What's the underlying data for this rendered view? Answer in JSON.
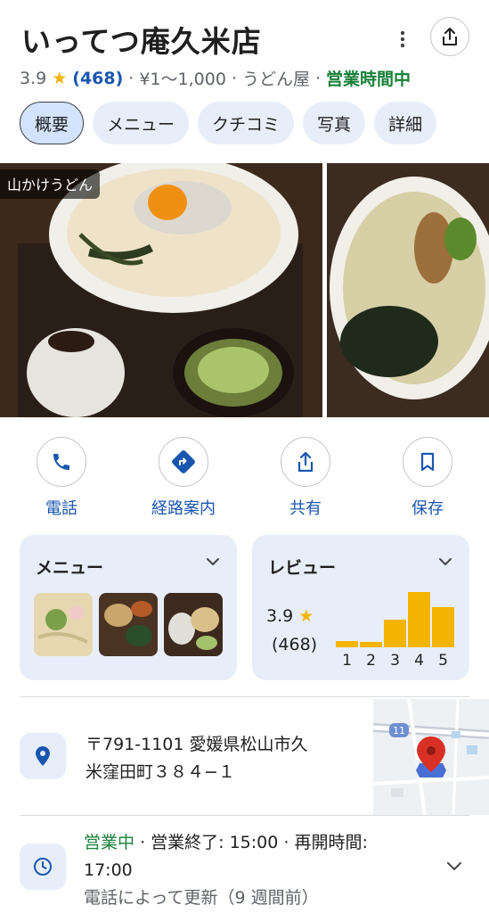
{
  "place": {
    "name": "いってつ庵久米店",
    "rating": "3.9",
    "rating_star": "★",
    "review_count": "(468)",
    "price": "¥1～1,000",
    "category": "うどん屋",
    "status": "営業時間中",
    "sep": "·"
  },
  "chips": [
    {
      "label": "概要"
    },
    {
      "label": "メニュー"
    },
    {
      "label": "クチコミ"
    },
    {
      "label": "写真"
    },
    {
      "label": "詳細"
    }
  ],
  "photos": {
    "label": "山かけうどん"
  },
  "actions": [
    {
      "label": "電話",
      "icon": "phone-icon"
    },
    {
      "label": "経路案内",
      "icon": "directions-icon"
    },
    {
      "label": "共有",
      "icon": "share-icon"
    },
    {
      "label": "保存",
      "icon": "bookmark-icon"
    }
  ],
  "menu_card": {
    "title": "メニュー"
  },
  "review_card": {
    "title": "レビュー",
    "rating": "3.9",
    "star": "★",
    "count": "(468)"
  },
  "chart_data": {
    "type": "bar",
    "categories": [
      "1",
      "2",
      "3",
      "4",
      "5"
    ],
    "values": [
      7,
      6,
      31,
      62,
      45
    ],
    "title": "",
    "xlabel": "",
    "ylabel": "",
    "color": "#f4b400"
  },
  "address": {
    "line1": "〒791-1101 愛媛県松山市久",
    "line2": "米窪田町３８４−１",
    "map_road_label": "11"
  },
  "hours": {
    "status": "営業中",
    "sep": "·",
    "close_text": "営業終了: 15:00",
    "reopen_text": "再開時間:",
    "reopen_time": "17:00",
    "updated": "電話によって更新（9 週間前）"
  },
  "colors": {
    "accent": "#1a56b0",
    "open_green": "#188038",
    "star": "#f4b400",
    "card_bg": "#e8eef9"
  }
}
